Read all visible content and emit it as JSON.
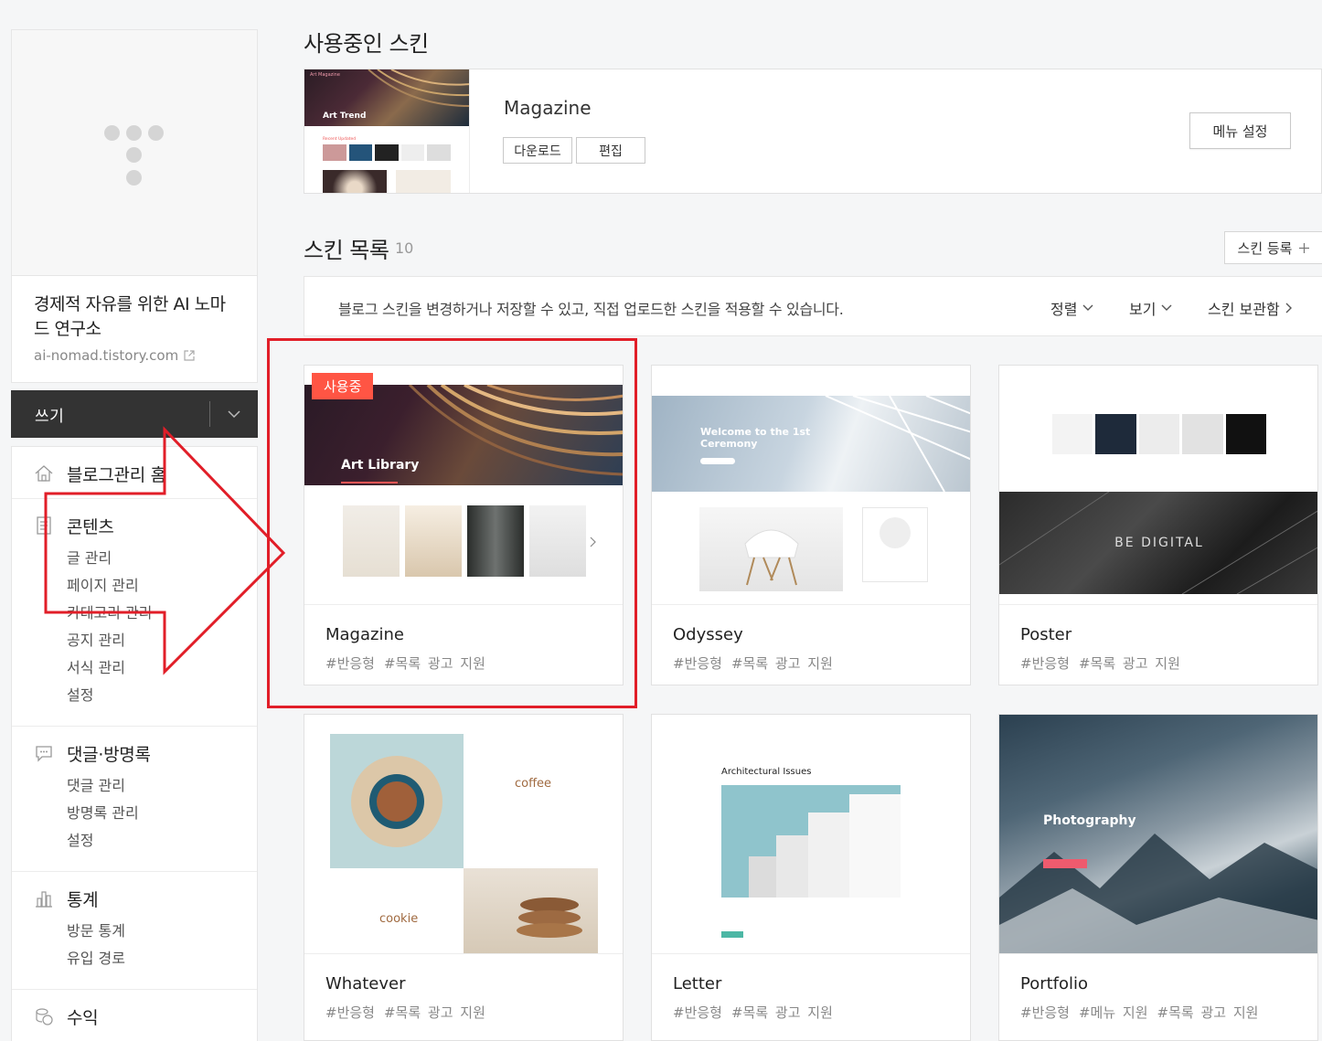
{
  "sidebar": {
    "blog_title": "경제적 자유를 위한 AI 노마드 연구소",
    "blog_url": "ai-nomad.tistory.com",
    "write_label": "쓰기",
    "menu": [
      {
        "title": "블로그관리 홈",
        "icon": "home-icon",
        "items": []
      },
      {
        "title": "콘텐츠",
        "icon": "document-icon",
        "items": [
          "글 관리",
          "페이지 관리",
          "카테고리 관리",
          "공지 관리",
          "서식 관리",
          "설정"
        ]
      },
      {
        "title": "댓글·방명록",
        "icon": "speech-bubble-icon",
        "items": [
          "댓글 관리",
          "방명록 관리",
          "설정"
        ]
      },
      {
        "title": "통계",
        "icon": "bar-chart-icon",
        "items": [
          "방문 통계",
          "유입 경로"
        ]
      },
      {
        "title": "수익",
        "icon": "coins-icon",
        "items": []
      }
    ]
  },
  "current_skin": {
    "section_title": "사용중인 스킨",
    "name": "Magazine",
    "download_label": "다운로드",
    "edit_label": "편집",
    "menu_settings_label": "메뉴 설정",
    "thumb_title": "Art Trend",
    "thumb_brand": "Art Magazine",
    "thumb_section": "Recent Updated"
  },
  "skin_list": {
    "section_title": "스킨 목록",
    "count": "10",
    "register_label": "스킨 등록",
    "info_text": "블로그 스킨을 변경하거나 저장할 수 있고, 직접 업로드한 스킨을 적용할 수 있습니다.",
    "sort_label": "정렬",
    "view_label": "보기",
    "storage_label": "스킨 보관함",
    "in_use_badge": "사용중",
    "skins": [
      {
        "name": "Magazine",
        "tags": [
          "#반응형",
          "#목록 광고 지원"
        ],
        "preview_title": "Art Library"
      },
      {
        "name": "Odyssey",
        "tags": [
          "#반응형",
          "#목록 광고 지원"
        ],
        "preview_title": "Welcome to the 1st Ceremony"
      },
      {
        "name": "Poster",
        "tags": [
          "#반응형",
          "#목록 광고 지원"
        ],
        "preview_title": "BE DIGITAL"
      },
      {
        "name": "Whatever",
        "tags": [
          "#반응형",
          "#목록 광고 지원"
        ],
        "preview_title": "coffee",
        "preview_sub": "cookie"
      },
      {
        "name": "Letter",
        "tags": [
          "#반응형",
          "#목록 광고 지원"
        ],
        "preview_title": "Architectural Issues"
      },
      {
        "name": "Portfolio",
        "tags": [
          "#반응형",
          "#메뉴 지원",
          "#목록 광고 지원"
        ],
        "preview_title": "Photography"
      }
    ]
  },
  "colors": {
    "accent_red": "#e11e28",
    "badge": "#ff5544",
    "write_bar": "#333333"
  }
}
